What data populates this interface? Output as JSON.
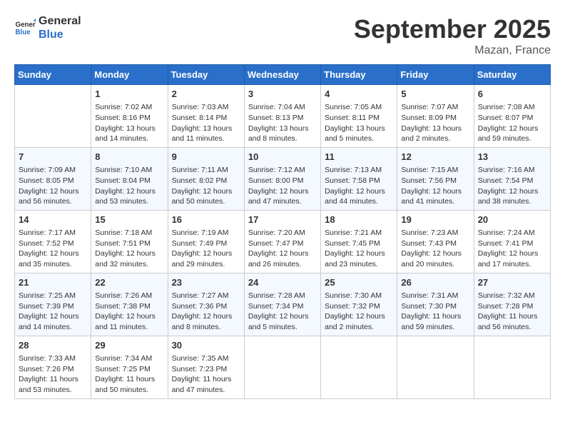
{
  "header": {
    "logo_line1": "General",
    "logo_line2": "Blue",
    "month_title": "September 2025",
    "location": "Mazan, France"
  },
  "days_of_week": [
    "Sunday",
    "Monday",
    "Tuesday",
    "Wednesday",
    "Thursday",
    "Friday",
    "Saturday"
  ],
  "weeks": [
    [
      {
        "day": "",
        "info": ""
      },
      {
        "day": "1",
        "info": "Sunrise: 7:02 AM\nSunset: 8:16 PM\nDaylight: 13 hours\nand 14 minutes."
      },
      {
        "day": "2",
        "info": "Sunrise: 7:03 AM\nSunset: 8:14 PM\nDaylight: 13 hours\nand 11 minutes."
      },
      {
        "day": "3",
        "info": "Sunrise: 7:04 AM\nSunset: 8:13 PM\nDaylight: 13 hours\nand 8 minutes."
      },
      {
        "day": "4",
        "info": "Sunrise: 7:05 AM\nSunset: 8:11 PM\nDaylight: 13 hours\nand 5 minutes."
      },
      {
        "day": "5",
        "info": "Sunrise: 7:07 AM\nSunset: 8:09 PM\nDaylight: 13 hours\nand 2 minutes."
      },
      {
        "day": "6",
        "info": "Sunrise: 7:08 AM\nSunset: 8:07 PM\nDaylight: 12 hours\nand 59 minutes."
      }
    ],
    [
      {
        "day": "7",
        "info": "Sunrise: 7:09 AM\nSunset: 8:05 PM\nDaylight: 12 hours\nand 56 minutes."
      },
      {
        "day": "8",
        "info": "Sunrise: 7:10 AM\nSunset: 8:04 PM\nDaylight: 12 hours\nand 53 minutes."
      },
      {
        "day": "9",
        "info": "Sunrise: 7:11 AM\nSunset: 8:02 PM\nDaylight: 12 hours\nand 50 minutes."
      },
      {
        "day": "10",
        "info": "Sunrise: 7:12 AM\nSunset: 8:00 PM\nDaylight: 12 hours\nand 47 minutes."
      },
      {
        "day": "11",
        "info": "Sunrise: 7:13 AM\nSunset: 7:58 PM\nDaylight: 12 hours\nand 44 minutes."
      },
      {
        "day": "12",
        "info": "Sunrise: 7:15 AM\nSunset: 7:56 PM\nDaylight: 12 hours\nand 41 minutes."
      },
      {
        "day": "13",
        "info": "Sunrise: 7:16 AM\nSunset: 7:54 PM\nDaylight: 12 hours\nand 38 minutes."
      }
    ],
    [
      {
        "day": "14",
        "info": "Sunrise: 7:17 AM\nSunset: 7:52 PM\nDaylight: 12 hours\nand 35 minutes."
      },
      {
        "day": "15",
        "info": "Sunrise: 7:18 AM\nSunset: 7:51 PM\nDaylight: 12 hours\nand 32 minutes."
      },
      {
        "day": "16",
        "info": "Sunrise: 7:19 AM\nSunset: 7:49 PM\nDaylight: 12 hours\nand 29 minutes."
      },
      {
        "day": "17",
        "info": "Sunrise: 7:20 AM\nSunset: 7:47 PM\nDaylight: 12 hours\nand 26 minutes."
      },
      {
        "day": "18",
        "info": "Sunrise: 7:21 AM\nSunset: 7:45 PM\nDaylight: 12 hours\nand 23 minutes."
      },
      {
        "day": "19",
        "info": "Sunrise: 7:23 AM\nSunset: 7:43 PM\nDaylight: 12 hours\nand 20 minutes."
      },
      {
        "day": "20",
        "info": "Sunrise: 7:24 AM\nSunset: 7:41 PM\nDaylight: 12 hours\nand 17 minutes."
      }
    ],
    [
      {
        "day": "21",
        "info": "Sunrise: 7:25 AM\nSunset: 7:39 PM\nDaylight: 12 hours\nand 14 minutes."
      },
      {
        "day": "22",
        "info": "Sunrise: 7:26 AM\nSunset: 7:38 PM\nDaylight: 12 hours\nand 11 minutes."
      },
      {
        "day": "23",
        "info": "Sunrise: 7:27 AM\nSunset: 7:36 PM\nDaylight: 12 hours\nand 8 minutes."
      },
      {
        "day": "24",
        "info": "Sunrise: 7:28 AM\nSunset: 7:34 PM\nDaylight: 12 hours\nand 5 minutes."
      },
      {
        "day": "25",
        "info": "Sunrise: 7:30 AM\nSunset: 7:32 PM\nDaylight: 12 hours\nand 2 minutes."
      },
      {
        "day": "26",
        "info": "Sunrise: 7:31 AM\nSunset: 7:30 PM\nDaylight: 11 hours\nand 59 minutes."
      },
      {
        "day": "27",
        "info": "Sunrise: 7:32 AM\nSunset: 7:28 PM\nDaylight: 11 hours\nand 56 minutes."
      }
    ],
    [
      {
        "day": "28",
        "info": "Sunrise: 7:33 AM\nSunset: 7:26 PM\nDaylight: 11 hours\nand 53 minutes."
      },
      {
        "day": "29",
        "info": "Sunrise: 7:34 AM\nSunset: 7:25 PM\nDaylight: 11 hours\nand 50 minutes."
      },
      {
        "day": "30",
        "info": "Sunrise: 7:35 AM\nSunset: 7:23 PM\nDaylight: 11 hours\nand 47 minutes."
      },
      {
        "day": "",
        "info": ""
      },
      {
        "day": "",
        "info": ""
      },
      {
        "day": "",
        "info": ""
      },
      {
        "day": "",
        "info": ""
      }
    ]
  ]
}
